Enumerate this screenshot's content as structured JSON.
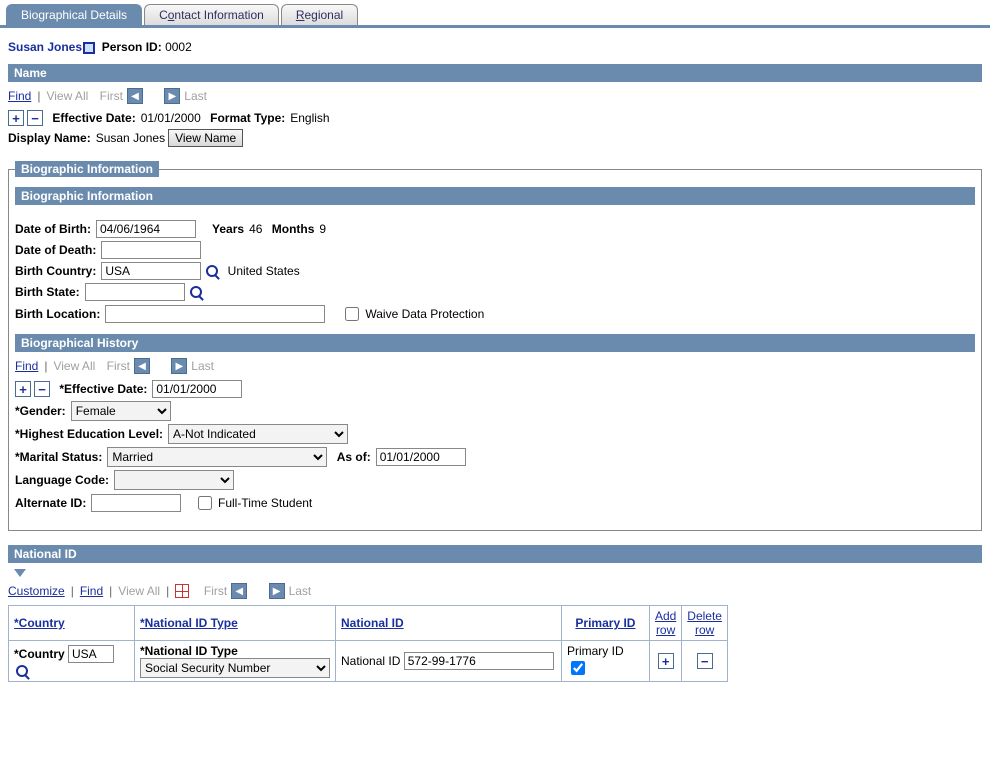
{
  "tabs": {
    "t0": "Biographical Details",
    "t1_pre": "C",
    "t1_ul": "o",
    "t1_post": "ntact Information",
    "t2_pre": "",
    "t2_ul": "R",
    "t2_post": "egional"
  },
  "person": {
    "name": "Susan Jones",
    "id_label": "Person ID:",
    "id_value": "0002"
  },
  "name_section": {
    "header": "Name",
    "find": "Find",
    "view_all": "View All",
    "first": "First",
    "last": "Last",
    "eff_date_label": "Effective Date:",
    "eff_date_value": "01/01/2000",
    "format_type_label": "Format Type:",
    "format_type_value": "English",
    "display_name_label": "Display Name:",
    "display_name_value": "Susan Jones",
    "view_name_btn": "View Name"
  },
  "bio_info": {
    "legend": "Biographic Information",
    "header": "Biographic Information",
    "dob_label": "Date of Birth:",
    "dob_value": "04/06/1964",
    "years_label": "Years",
    "years_value": "46",
    "months_label": "Months",
    "months_value": "9",
    "dod_label": "Date of Death:",
    "dod_value": "",
    "birth_country_label": "Birth Country:",
    "birth_country_value": "USA",
    "birth_country_desc": "United States",
    "birth_state_label": "Birth State:",
    "birth_state_value": "",
    "birth_loc_label": "Birth Location:",
    "birth_loc_value": "",
    "waive_label": "Waive Data Protection"
  },
  "bio_hist": {
    "header": "Biographical History",
    "find": "Find",
    "view_all": "View All",
    "first": "First",
    "last": "Last",
    "eff_date_label": "*Effective Date:",
    "eff_date_value": "01/01/2000",
    "gender_label": "*Gender:",
    "gender_value": "Female",
    "edu_label": "*Highest Education Level:",
    "edu_value": "A-Not Indicated",
    "marital_label": "*Marital Status:",
    "marital_value": "Married",
    "asof_label": "As of:",
    "asof_value": "01/01/2000",
    "lang_label": "Language Code:",
    "lang_value": "",
    "altid_label": "Alternate ID:",
    "altid_value": "",
    "fulltime_label": "Full-Time Student"
  },
  "natid": {
    "header": "National ID",
    "customize": "Customize",
    "find": "Find",
    "view_all": "View All",
    "first": "First",
    "last": "Last",
    "col_country": "*Country",
    "col_nidtype": "*National ID Type",
    "col_nid": "National ID",
    "col_primary": "Primary ID",
    "col_add": "Add row",
    "col_delete": "Delete row",
    "row1": {
      "country_label": "*Country",
      "country_value": "USA",
      "nidtype_label": "*National ID Type",
      "nidtype_value": "Social Security Number",
      "nid_label": "National ID",
      "nid_value": "572-99-1776",
      "primary_label": "Primary ID",
      "primary_checked": true
    }
  }
}
